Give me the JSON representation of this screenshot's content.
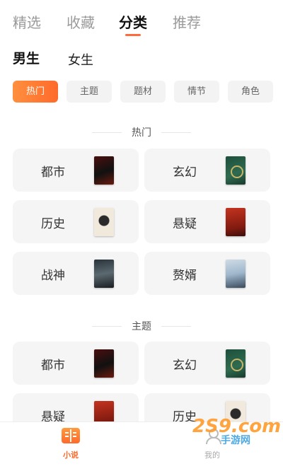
{
  "top_tabs": [
    {
      "label": "精选"
    },
    {
      "label": "收藏"
    },
    {
      "label": "分类"
    },
    {
      "label": "推荐"
    }
  ],
  "active_top_tab": "分类",
  "gender_tabs": [
    {
      "label": "男生"
    },
    {
      "label": "女生"
    }
  ],
  "active_gender": "男生",
  "chips": [
    {
      "label": "热门"
    },
    {
      "label": "主题"
    },
    {
      "label": "题材"
    },
    {
      "label": "情节"
    },
    {
      "label": "角色"
    }
  ],
  "active_chip": "热门",
  "sections": [
    {
      "title": "热门",
      "cards": [
        {
          "label": "都市",
          "cover": "red-dark-cover"
        },
        {
          "label": "玄幻",
          "cover": "green-emblem-cover"
        },
        {
          "label": "历史",
          "cover": "ink-circle-cover"
        },
        {
          "label": "悬疑",
          "cover": "red-calligraphy-cover"
        },
        {
          "label": "战神",
          "cover": "dark-warrior-cover"
        },
        {
          "label": "赘婿",
          "cover": "light-portrait-cover"
        }
      ]
    },
    {
      "title": "主题",
      "cards": [
        {
          "label": "都市",
          "cover": "red-dark-cover"
        },
        {
          "label": "玄幻",
          "cover": "green-emblem-cover"
        },
        {
          "label": "悬疑",
          "cover": "red-calligraphy-cover"
        },
        {
          "label": "历史",
          "cover": "ink-circle-cover"
        }
      ]
    }
  ],
  "bottom_nav": [
    {
      "label": "小说",
      "icon": "book-icon"
    },
    {
      "label": "我的",
      "icon": "user-icon"
    }
  ],
  "active_bottom_nav": "小说",
  "watermark": {
    "text": "2S9.com",
    "sub": "手游网"
  },
  "colors": {
    "accent": "#ff6a2b",
    "accent_light": "#ff8f3e",
    "card_bg": "#f5f5f5",
    "chip_bg": "#f3f3f3"
  }
}
